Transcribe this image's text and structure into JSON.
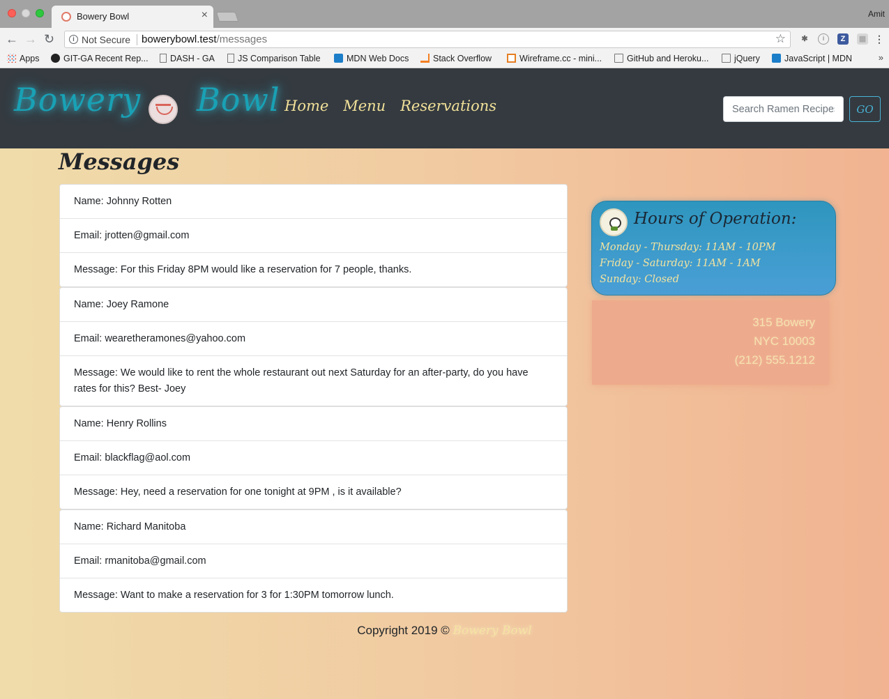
{
  "browser": {
    "tab_title": "Bowery Bowl",
    "profile_name": "Amit",
    "security_label": "Not Secure",
    "url_host": "bowerybowl.test",
    "url_path": "/messages",
    "bookmarks": [
      "Apps",
      "GIT-GA Recent Rep...",
      "DASH - GA",
      "JS Comparison Table",
      "MDN Web Docs",
      "Stack Overflow",
      "Wireframe.cc - mini...",
      "GitHub and Heroku...",
      "jQuery",
      "JavaScript | MDN"
    ],
    "more_bookmarks": "»"
  },
  "site": {
    "brand_word1": "Bowery",
    "brand_word2": "Bowl",
    "nav": [
      "Home",
      "Menu",
      "Reservations"
    ],
    "search_placeholder": "Search Ramen Recipes",
    "search_button": "GO",
    "colors": {
      "navbar": "#343a40",
      "brand": "#19a1b5",
      "nav_link": "#f2e199",
      "hours_card": "#3498c8",
      "address_box": "#eeaa8c"
    }
  },
  "page_title": "Messages",
  "messages": [
    {
      "name": "Name: Johnny Rotten",
      "email": "Email: jrotten@gmail.com",
      "message": "Message: For this Friday 8PM would like a reservation for 7 people, thanks."
    },
    {
      "name": "Name: Joey Ramone",
      "email": "Email: wearetheramones@yahoo.com",
      "message": "Message: We would like to rent the whole restaurant out next Saturday for an after-party, do you have rates for this? Best- Joey"
    },
    {
      "name": "Name: Henry Rollins",
      "email": "Email: blackflag@aol.com",
      "message": "Message: Hey, need a reservation for one tonight at 9PM , is it available?"
    },
    {
      "name": "Name: Richard Manitoba",
      "email": "Email: rmanitoba@gmail.com",
      "message": "Message: Want to make a reservation for 3 for 1:30PM tomorrow lunch."
    }
  ],
  "hours": {
    "title": "Hours of Operation:",
    "lines": [
      "Monday - Thursday: 11AM - 10PM",
      "Friday - Saturday: 11AM - 1AM",
      "Sunday: Closed"
    ]
  },
  "address": [
    "315 Bowery",
    "NYC 10003",
    "(212) 555.1212"
  ],
  "footer": {
    "copyright": "Copyright 2019 © ",
    "brand": "Bowery Bowl"
  }
}
